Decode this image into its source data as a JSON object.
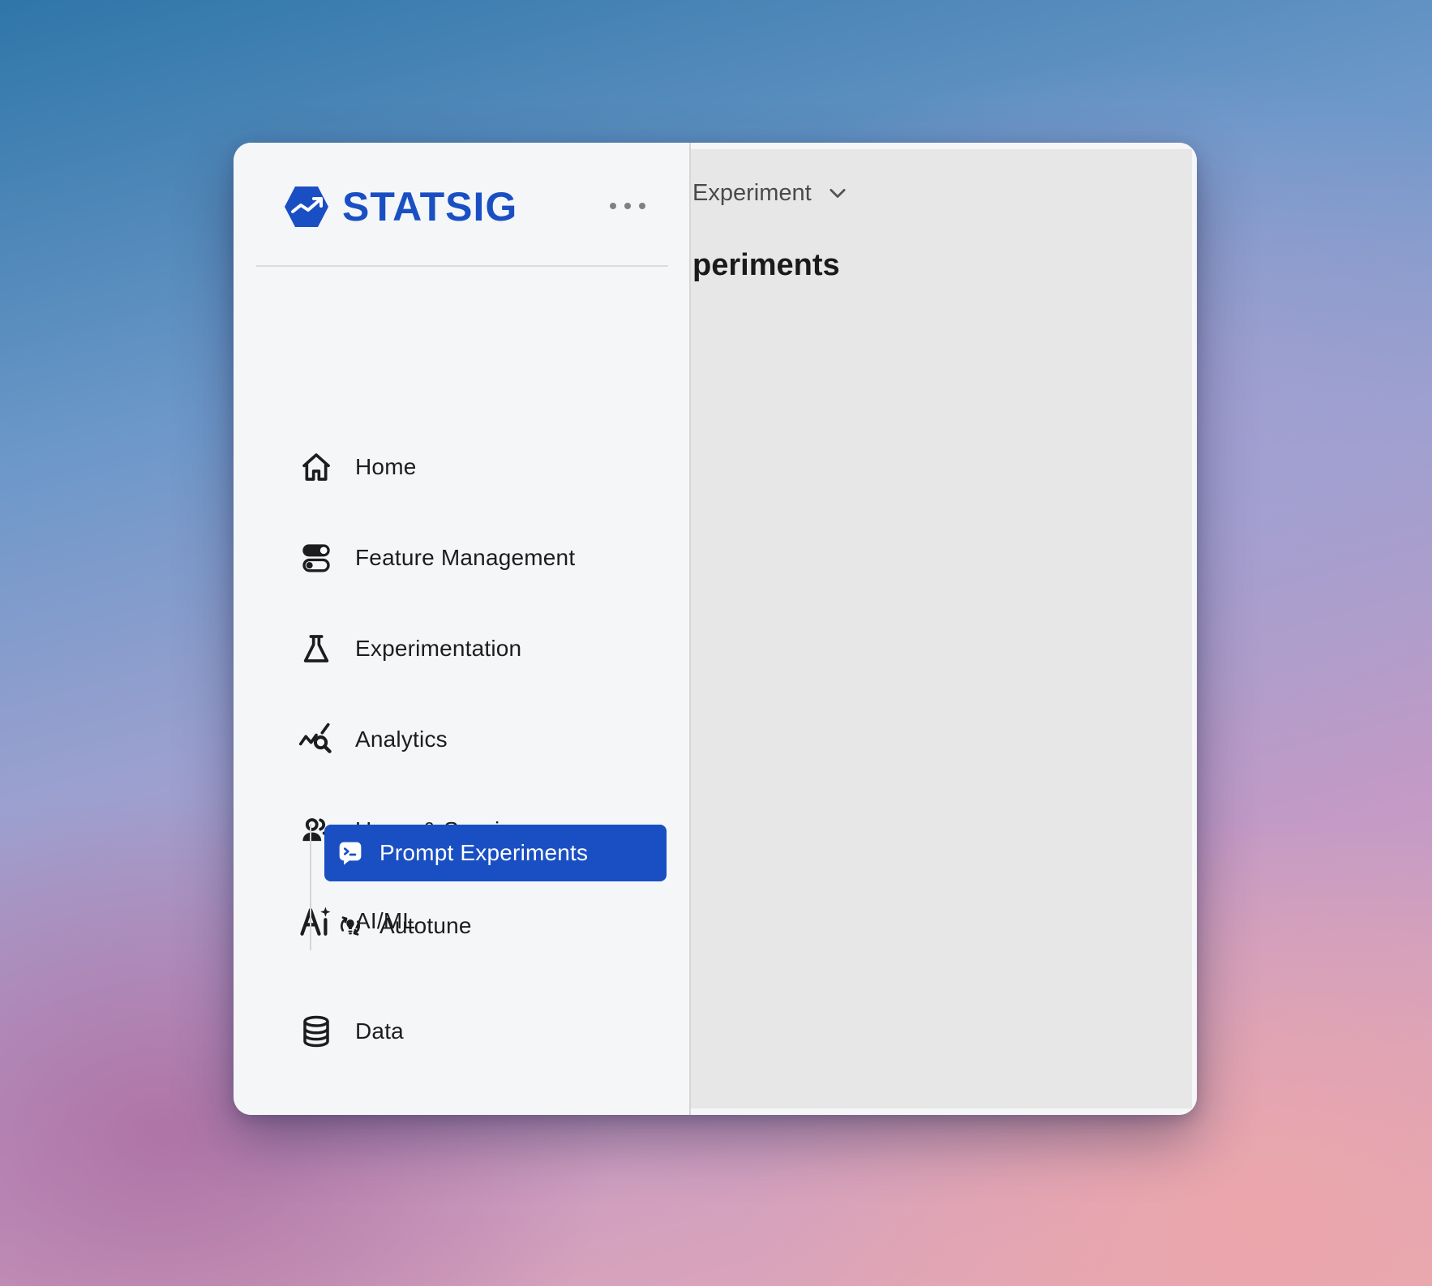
{
  "brand": {
    "name": "STATSIG",
    "color": "#1a4fc4"
  },
  "nav": {
    "items": [
      {
        "label": "Home",
        "icon": "home-icon"
      },
      {
        "label": "Feature Management",
        "icon": "toggle-icon"
      },
      {
        "label": "Experimentation",
        "icon": "flask-icon"
      },
      {
        "label": "Analytics",
        "icon": "analytics-search-icon"
      },
      {
        "label": "Users & Sessions",
        "icon": "users-icon"
      },
      {
        "label": "AI/ML",
        "icon": "ai-sparkle-icon"
      },
      {
        "label": "Data",
        "icon": "database-icon"
      }
    ],
    "ai_sub": [
      {
        "label": "Prompt Experiments",
        "icon": "prompt-chat-icon",
        "active": true
      },
      {
        "label": "Autotune",
        "icon": "autotune-icon",
        "active": false
      }
    ]
  },
  "main": {
    "dropdown_label": "Experiment",
    "page_title": "Prompt Experiments"
  },
  "colors": {
    "accent": "#1a4fc4",
    "sidebar_bg": "#f4f6f8",
    "main_bg": "#e7e7e7"
  }
}
